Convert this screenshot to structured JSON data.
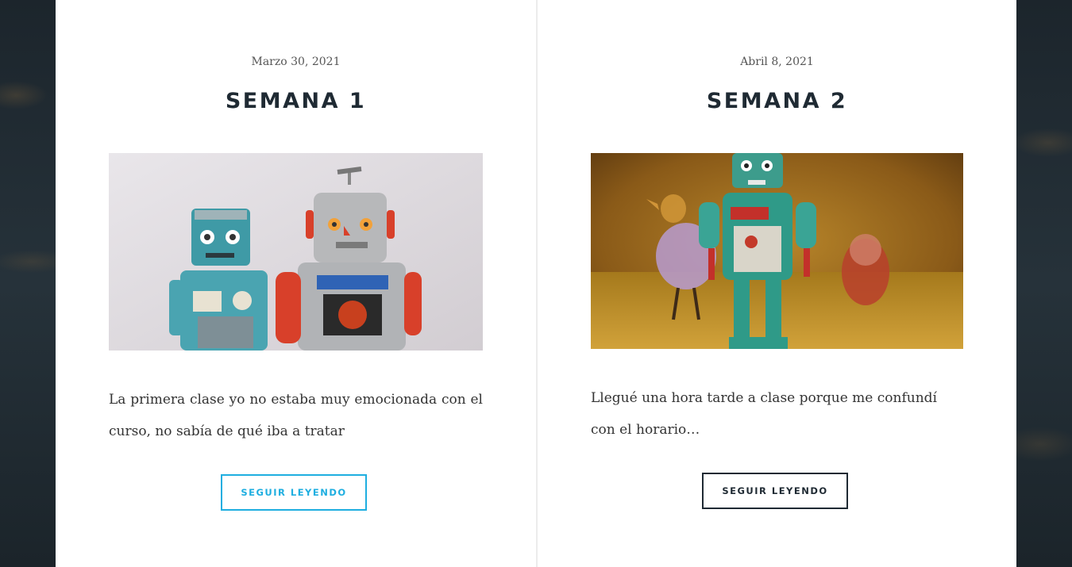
{
  "posts": [
    {
      "date": "Marzo 30, 2021",
      "title": "SEMANA 1",
      "excerpt": "La primera clase yo no estaba muy emocionada con el curso, no sabía de qué iba a tratar",
      "button_label": "SEGUIR LEYENDO",
      "image_alt": "two vintage tin toy robots"
    },
    {
      "date": "Abril 8, 2021",
      "title": "SEMANA 2",
      "excerpt": "Llegué una hora tarde a clase porque me confundí con el horario…",
      "button_label": "SEGUIR LEYENDO",
      "image_alt": "green tin toy robot with blurred toys"
    }
  ],
  "colors": {
    "accent": "#1eaee0",
    "heading": "#1f2a33",
    "background": "#1f2a31"
  }
}
